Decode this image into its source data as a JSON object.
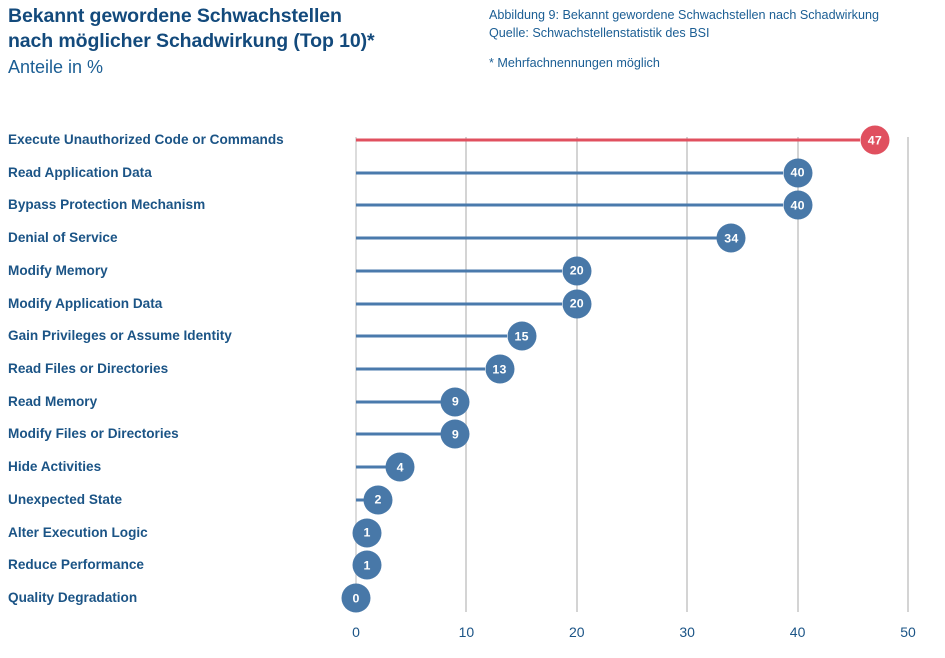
{
  "header": {
    "title_lines": [
      "Bekannt gewordene Schwachstellen",
      "nach möglicher Schadwirkung (Top 10)*"
    ],
    "subtitle": "Anteile in %",
    "caption_lines": [
      "Abbildung 9: Bekannt gewordene  Schwachstellen nach Schadwirkung",
      "Quelle: Schwachstellenstatistik des BSI"
    ],
    "footnote": "* Mehrfachnennungen möglich"
  },
  "colors": {
    "accent_red": "#e0505f",
    "bar_blue": "#4878a8",
    "text_blue": "#1b5486",
    "title_blue": "#134a7c",
    "gridline": "#d4d4d4"
  },
  "chart_data": {
    "type": "bar",
    "title": "Bekannt gewordene Schwachstellen nach möglicher Schadwirkung (Top 10)*",
    "subtitle": "Anteile in %",
    "xlabel": "",
    "ylabel": "",
    "orientation": "horizontal",
    "xlim": [
      0,
      50
    ],
    "xticks": [
      "0",
      "10",
      "20",
      "30",
      "40",
      "50"
    ],
    "xtick_values": [
      0,
      10,
      20,
      30,
      40,
      50
    ],
    "grid": "vertical",
    "legend": "none",
    "categories": [
      "Execute Unauthorized Code or Commands",
      "Read Application Data",
      "Bypass Protection Mechanism",
      "Denial of Service",
      "Modify Memory",
      "Modify Application Data",
      "Gain Privileges or Assume Identity",
      "Read Files or Directories",
      "Read Memory",
      "Modify Files or Directories",
      "Hide Activities",
      "Unexpected State",
      "Alter Execution Logic",
      "Reduce Performance",
      "Quality Degradation"
    ],
    "values": [
      47,
      40,
      40,
      34,
      20,
      20,
      15,
      13,
      9,
      9,
      4,
      2,
      1,
      1,
      0
    ],
    "value_labels": [
      "47",
      "40",
      "40",
      "34",
      "20",
      "20",
      "15",
      "13",
      "9",
      "9",
      "4",
      "2",
      "1",
      "1",
      "0"
    ],
    "highlight_index": 0
  }
}
